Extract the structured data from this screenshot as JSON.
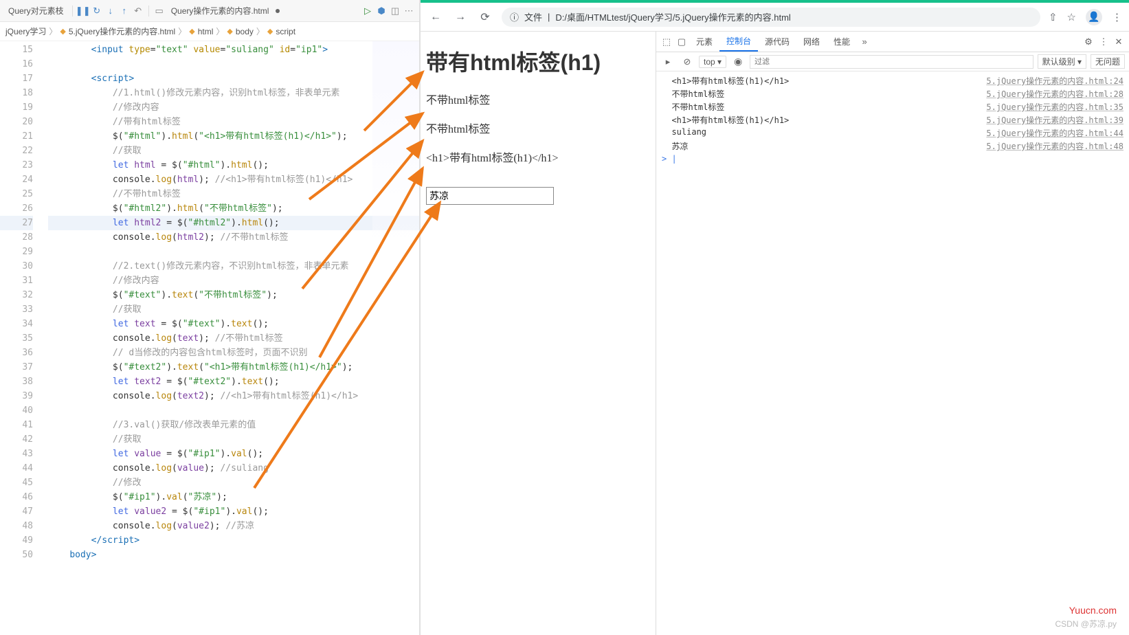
{
  "editor": {
    "tab1": "Query对元素枝",
    "tab2": "Query操作元素的内容.html",
    "breadcrumb": {
      "folder": "jQuery学习",
      "file": "5.jQuery操作元素的内容.html",
      "p1": "html",
      "p2": "body",
      "p3": "script"
    },
    "lines": [
      {
        "n": 15,
        "ind": 2,
        "html": "<span class='tok-tag'>&lt;input</span> <span class='tok-attr'>type</span>=<span class='tok-str'>\"text\"</span> <span class='tok-attr'>value</span>=<span class='tok-str'>\"suliang\"</span> <span class='tok-attr'>id</span>=<span class='tok-str'>\"ip1\"</span><span class='tok-tag'>&gt;</span>"
      },
      {
        "n": 16,
        "ind": 2,
        "html": ""
      },
      {
        "n": 17,
        "ind": 2,
        "html": "<span class='tok-tag'>&lt;script&gt;</span>"
      },
      {
        "n": 18,
        "ind": 3,
        "html": "<span class='tok-com'>//1.html()修改元素内容，识别html标签，非表单元素</span>"
      },
      {
        "n": 19,
        "ind": 3,
        "html": "<span class='tok-com'>//修改内容</span>"
      },
      {
        "n": 20,
        "ind": 3,
        "html": "<span class='tok-com'>//带有html标签</span>"
      },
      {
        "n": 21,
        "ind": 3,
        "html": "$(<span class='tok-str'>\"#html\"</span>).<span class='tok-fn'>html</span>(<span class='tok-str'>\"&lt;h1&gt;带有html标签(h1)&lt;/h1&gt;\"</span>);"
      },
      {
        "n": 22,
        "ind": 3,
        "html": "<span class='tok-com'>//获取</span>"
      },
      {
        "n": 23,
        "ind": 3,
        "html": "<span class='tok-kw'>let</span> <span class='tok-var'>html</span> = $(<span class='tok-str'>\"#html\"</span>).<span class='tok-fn'>html</span>();"
      },
      {
        "n": 24,
        "ind": 3,
        "html": "console.<span class='tok-fn'>log</span>(<span class='tok-var'>html</span>); <span class='tok-com'>//&lt;h1&gt;带有html标签(h1)&lt;/h1&gt;</span>"
      },
      {
        "n": 25,
        "ind": 3,
        "html": "<span class='tok-com'>//不带html标签</span>"
      },
      {
        "n": 26,
        "ind": 3,
        "html": "$(<span class='tok-str'>\"#html2\"</span>).<span class='tok-fn'>html</span>(<span class='tok-str'>\"不带html标签\"</span>);"
      },
      {
        "n": 27,
        "ind": 3,
        "html": "<span class='tok-kw'>let</span> <span class='tok-var'>html2</span> = $(<span class='tok-str'>\"#html2\"</span>).<span class='tok-fn'>html</span>();",
        "hl": true
      },
      {
        "n": 28,
        "ind": 3,
        "html": "console.<span class='tok-fn'>log</span>(<span class='tok-var'>html2</span>); <span class='tok-com'>//不带html标签</span>"
      },
      {
        "n": 29,
        "ind": 3,
        "html": ""
      },
      {
        "n": 30,
        "ind": 3,
        "html": "<span class='tok-com'>//2.text()修改元素内容，不识别html标签，非表单元素</span>"
      },
      {
        "n": 31,
        "ind": 3,
        "html": "<span class='tok-com'>//修改内容</span>"
      },
      {
        "n": 32,
        "ind": 3,
        "html": "$(<span class='tok-str'>\"#text\"</span>).<span class='tok-fn'>text</span>(<span class='tok-str'>\"不带html标签\"</span>);"
      },
      {
        "n": 33,
        "ind": 3,
        "html": "<span class='tok-com'>//获取</span>"
      },
      {
        "n": 34,
        "ind": 3,
        "html": "<span class='tok-kw'>let</span> <span class='tok-var'>text</span> = $(<span class='tok-str'>\"#text\"</span>).<span class='tok-fn'>text</span>();"
      },
      {
        "n": 35,
        "ind": 3,
        "html": "console.<span class='tok-fn'>log</span>(<span class='tok-var'>text</span>); <span class='tok-com'>//不带html标签</span>"
      },
      {
        "n": 36,
        "ind": 3,
        "html": "<span class='tok-com'>// d当修改的内容包含html标签时，页面不识别</span>"
      },
      {
        "n": 37,
        "ind": 3,
        "html": "$(<span class='tok-str'>\"#text2\"</span>).<span class='tok-fn'>text</span>(<span class='tok-str'>\"&lt;h1&gt;带有html标签(h1)&lt;/h1&gt;\"</span>);"
      },
      {
        "n": 38,
        "ind": 3,
        "html": "<span class='tok-kw'>let</span> <span class='tok-var'>text2</span> = $(<span class='tok-str'>\"#text2\"</span>).<span class='tok-fn'>text</span>();"
      },
      {
        "n": 39,
        "ind": 3,
        "html": "console.<span class='tok-fn'>log</span>(<span class='tok-var'>text2</span>); <span class='tok-com'>//&lt;h1&gt;带有html标签(h1)&lt;/h1&gt;</span>"
      },
      {
        "n": 40,
        "ind": 3,
        "html": ""
      },
      {
        "n": 41,
        "ind": 3,
        "html": "<span class='tok-com'>//3.val()获取/修改表单元素的值</span>"
      },
      {
        "n": 42,
        "ind": 3,
        "html": "<span class='tok-com'>//获取</span>"
      },
      {
        "n": 43,
        "ind": 3,
        "html": "<span class='tok-kw'>let</span> <span class='tok-var'>value</span> = $(<span class='tok-str'>\"#ip1\"</span>).<span class='tok-fn'>val</span>();"
      },
      {
        "n": 44,
        "ind": 3,
        "html": "console.<span class='tok-fn'>log</span>(<span class='tok-var'>value</span>); <span class='tok-com'>//suliang</span>"
      },
      {
        "n": 45,
        "ind": 3,
        "html": "<span class='tok-com'>//修改</span>"
      },
      {
        "n": 46,
        "ind": 3,
        "html": "$(<span class='tok-str'>\"#ip1\"</span>).<span class='tok-fn'>val</span>(<span class='tok-str'>\"苏凉\"</span>);"
      },
      {
        "n": 47,
        "ind": 3,
        "html": "<span class='tok-kw'>let</span> <span class='tok-var'>value2</span> = $(<span class='tok-str'>\"#ip1\"</span>).<span class='tok-fn'>val</span>();"
      },
      {
        "n": 48,
        "ind": 3,
        "html": "console.<span class='tok-fn'>log</span>(<span class='tok-var'>value2</span>); <span class='tok-com'>//苏凉</span>"
      },
      {
        "n": 49,
        "ind": 2,
        "html": "<span class='tok-tag'>&lt;/script&gt;</span>"
      },
      {
        "n": 50,
        "ind": 1,
        "html": "<span class='tok-tag'>body&gt;</span>"
      }
    ]
  },
  "browser": {
    "url_scheme": "文件",
    "url_path": "D:/桌面/HTMLtest/jQuery学习/5.jQuery操作元素的内容.html",
    "page": {
      "h1": "带有html标签(h1)",
      "r2": "不带html标签",
      "r3": "不带html标签",
      "r4": "<h1>带有html标签(h1)</h1>",
      "input_value": "苏凉"
    }
  },
  "devtools": {
    "tabs": {
      "elements": "元素",
      "console": "控制台",
      "sources": "源代码",
      "network": "网络",
      "performance": "性能"
    },
    "toolbar": {
      "top": "top ▾",
      "filter_placeholder": "过滤",
      "level": "默认级别 ▾",
      "noissue": "无问题"
    },
    "console": [
      {
        "msg": "<h1>带有html标签(h1)</h1>",
        "src": "5.jQuery操作元素的内容.html:24"
      },
      {
        "msg": "不带html标签",
        "src": "5.jQuery操作元素的内容.html:28"
      },
      {
        "msg": "不带html标签",
        "src": "5.jQuery操作元素的内容.html:35"
      },
      {
        "msg": "<h1>带有html标签(h1)</h1>",
        "src": "5.jQuery操作元素的内容.html:39"
      },
      {
        "msg": "suliang",
        "src": "5.jQuery操作元素的内容.html:44"
      },
      {
        "msg": "苏凉",
        "src": "5.jQuery操作元素的内容.html:48"
      }
    ]
  },
  "watermarks": {
    "w1": "Yuucn.com",
    "w2": "CSDN @苏凉.py"
  }
}
